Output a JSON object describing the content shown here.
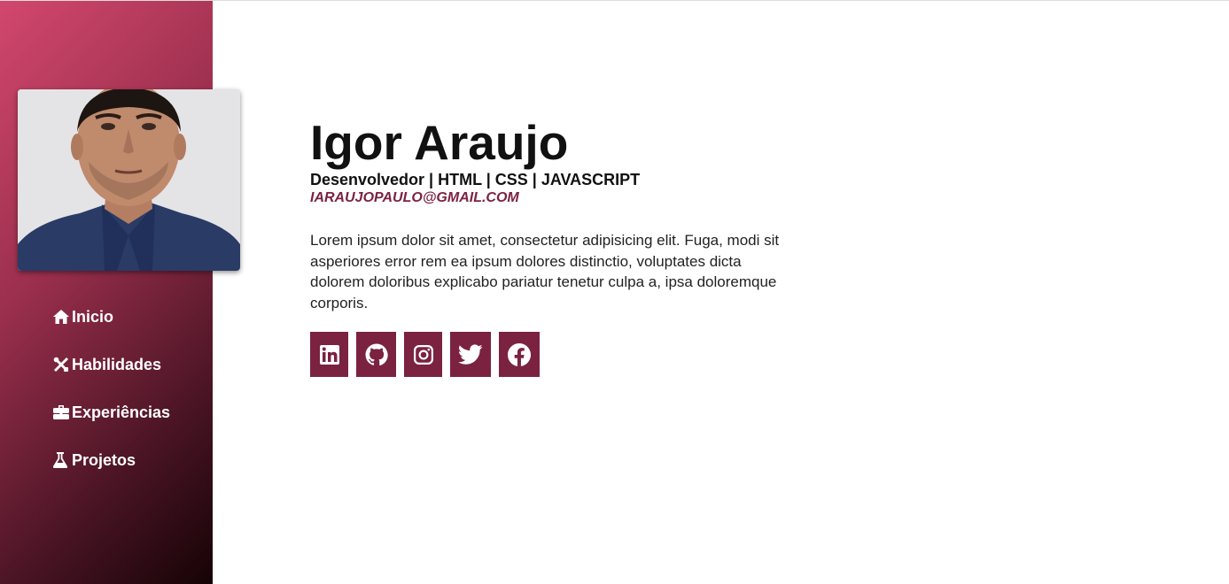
{
  "profile": {
    "name": "Igor Araujo",
    "role": "Desenvolvedor | HTML | CSS | JAVASCRIPT",
    "email": "IARAUJOPAULO@GMAIL.COM",
    "bio": "Lorem ipsum dolor sit amet, consectetur adipisicing elit. Fuga, modi sit asperiores error rem ea ipsum dolores distinctio, voluptates dicta dolorem doloribus explicabo pariatur tenetur culpa a, ipsa doloremque corporis."
  },
  "nav": {
    "items": [
      {
        "label": "Inicio",
        "icon": "home-icon"
      },
      {
        "label": "Habilidades",
        "icon": "tools-icon"
      },
      {
        "label": "Experiências",
        "icon": "briefcase-icon"
      },
      {
        "label": "Projetos",
        "icon": "flask-icon"
      }
    ]
  },
  "socials": [
    {
      "icon": "linkedin-icon"
    },
    {
      "icon": "github-icon"
    },
    {
      "icon": "instagram-icon"
    },
    {
      "icon": "twitter-icon"
    },
    {
      "icon": "facebook-icon"
    }
  ],
  "colors": {
    "accent": "#7b2240",
    "sidebar_start": "#d2476d",
    "sidebar_end": "#160306"
  }
}
